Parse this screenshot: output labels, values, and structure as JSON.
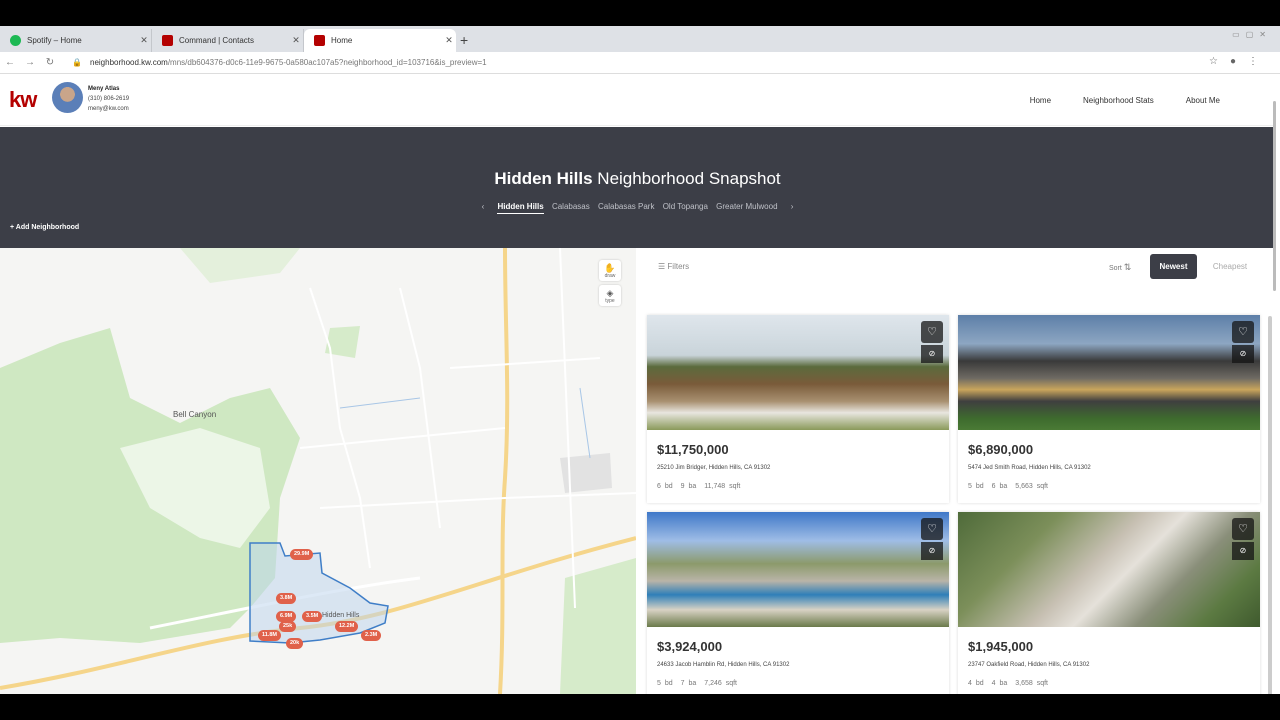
{
  "browser": {
    "tabs": [
      {
        "title": "Spotify – Home",
        "favicon": "spotify-icon"
      },
      {
        "title": "Command | Contacts",
        "favicon": "kw-icon"
      },
      {
        "title": "Home",
        "favicon": "kw-icon",
        "active": true
      }
    ],
    "url_host": "neighborhood.kw.com",
    "url_path": "/mns/db604376-d0c6-11e9-9675-0a580ac107a5?neighborhood_id=103716&is_preview=1"
  },
  "header": {
    "logo": "kw",
    "agent_name": "Meny Atlas",
    "agent_phone": "(310) 806-2619",
    "agent_email": "meny@kw.com",
    "nav": [
      "Home",
      "Neighborhood Stats",
      "About Me"
    ]
  },
  "hero": {
    "title_bold": "Hidden Hills",
    "title_rest": " Neighborhood Snapshot",
    "neighborhoods": [
      "Hidden Hills",
      "Calabasas",
      "Calabasas Park",
      "Old Topanga",
      "Greater Mulwood"
    ],
    "active_neighborhood": "Hidden Hills",
    "add_label": "+ Add Neighborhood"
  },
  "map": {
    "tools": [
      {
        "icon": "draw-icon",
        "label": "draw"
      },
      {
        "icon": "layers-icon",
        "label": "type"
      }
    ],
    "labels": {
      "bell_canyon": "Bell Canyon",
      "hidden_hills": "Hidden Hills"
    },
    "pins": [
      "29.9M",
      "3.8M",
      "6.9M",
      "3.5M",
      "25k",
      "11.8M",
      "12.2M",
      "2.3M",
      "20k"
    ]
  },
  "listings": {
    "filters_label": "Filters",
    "sort_label": "Sort",
    "newest_label": "Newest",
    "cheapest_label": "Cheapest",
    "items": [
      {
        "price": "$11,750,000",
        "address": "25210 Jim Bridger, Hidden Hills, CA 91302",
        "beds": "6 bd",
        "baths": "9 ba",
        "sqft": "11,748 sqft"
      },
      {
        "price": "$6,890,000",
        "address": "5474 Jed Smith Road, Hidden Hills, CA 91302",
        "beds": "5 bd",
        "baths": "6 ba",
        "sqft": "5,663 sqft"
      },
      {
        "price": "$3,924,000",
        "address": "24633 Jacob Hamblin Rd, Hidden Hills, CA 91302",
        "beds": "5 bd",
        "baths": "7 ba",
        "sqft": "7,246 sqft"
      },
      {
        "price": "$1,945,000",
        "address": "23747 Oakfield Road, Hidden Hills, CA 91302",
        "beds": "4 bd",
        "baths": "4 ba",
        "sqft": "3,658 sqft"
      }
    ]
  }
}
